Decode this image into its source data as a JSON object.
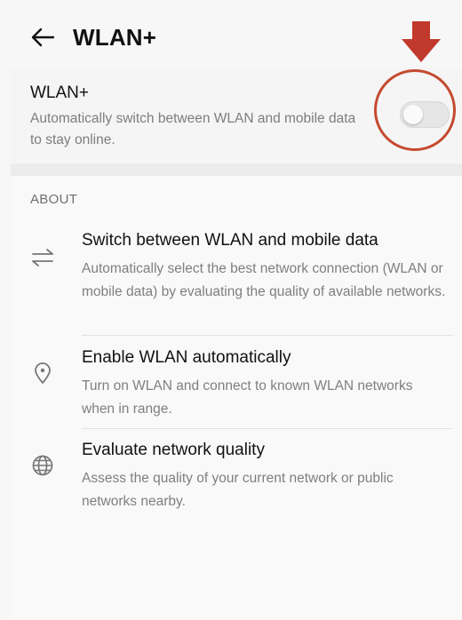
{
  "header": {
    "title": "WLAN+",
    "back_icon": "arrow-left-icon"
  },
  "annotation": {
    "arrow_icon": "red-down-arrow-icon",
    "color": "#c0392b"
  },
  "wlan_plus": {
    "title": "WLAN+",
    "description": "Automatically switch between WLAN and mobile data to stay online.",
    "toggle_state": "off"
  },
  "about": {
    "header": "ABOUT",
    "features": [
      {
        "icon": "switch-arrows-icon",
        "title": "Switch between WLAN and mobile data",
        "description": "Automatically select the best network connection (WLAN or mobile data) by evaluating the quality of available networks."
      },
      {
        "icon": "location-pin-icon",
        "title": "Enable WLAN automatically",
        "description": "Turn on WLAN and connect to known WLAN networks when in range."
      },
      {
        "icon": "globe-icon",
        "title": "Evaluate network quality",
        "description": "Assess the quality of your current network or public networks nearby."
      }
    ]
  }
}
